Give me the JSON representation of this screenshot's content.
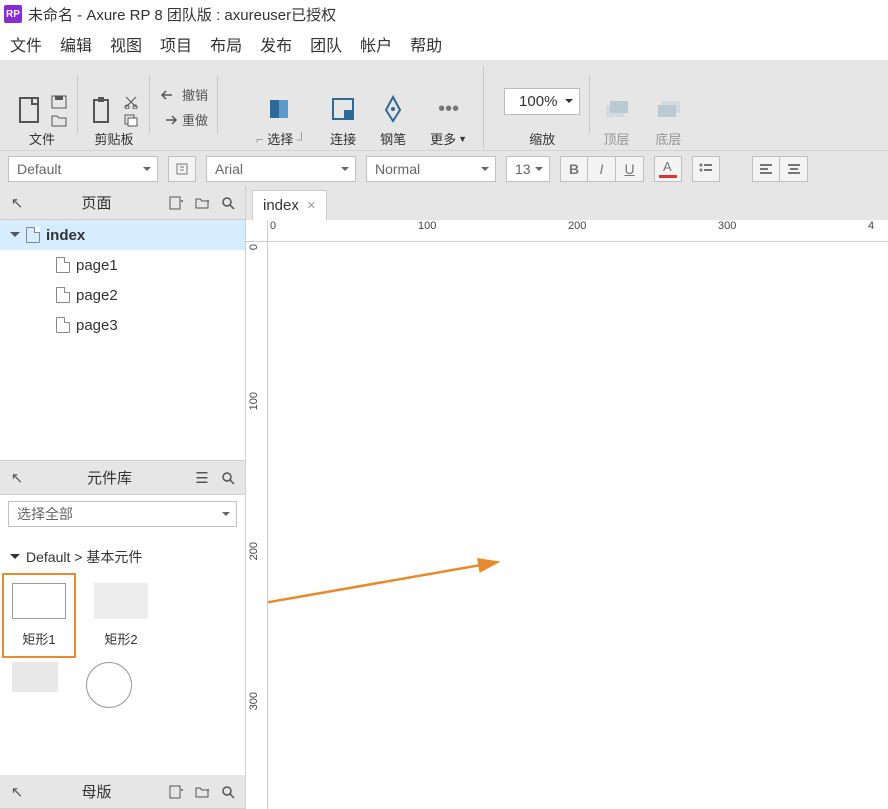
{
  "title": "未命名 - Axure RP 8 团队版 : axureuser已授权",
  "app_logo": "RP",
  "menu": [
    "文件",
    "编辑",
    "视图",
    "项目",
    "布局",
    "发布",
    "团队",
    "帐户",
    "帮助"
  ],
  "ribbon": {
    "file": "文件",
    "clipboard": "剪贴板",
    "undo": "撤销",
    "redo": "重做",
    "select": "选择",
    "connect": "连接",
    "pen": "钢笔",
    "more": "更多",
    "zoom_value": "100%",
    "zoom_label": "缩放",
    "top_layer": "顶层",
    "bottom_layer": "底层"
  },
  "fmt": {
    "style": "Default",
    "font": "Arial",
    "weight": "Normal",
    "size": "13"
  },
  "panels": {
    "pages": "页面",
    "library": "元件库",
    "library_select": "选择全部",
    "library_cat": "Default > 基本元件",
    "masters": "母版"
  },
  "pages": {
    "root": "index",
    "children": [
      "page1",
      "page2",
      "page3"
    ]
  },
  "widgets": {
    "rect1": "矩形1",
    "rect2": "矩形2"
  },
  "tab": {
    "name": "index"
  },
  "ruler_h": [
    "0",
    "100",
    "200",
    "300",
    "4"
  ],
  "ruler_v": [
    "0",
    "100",
    "200",
    "300"
  ]
}
